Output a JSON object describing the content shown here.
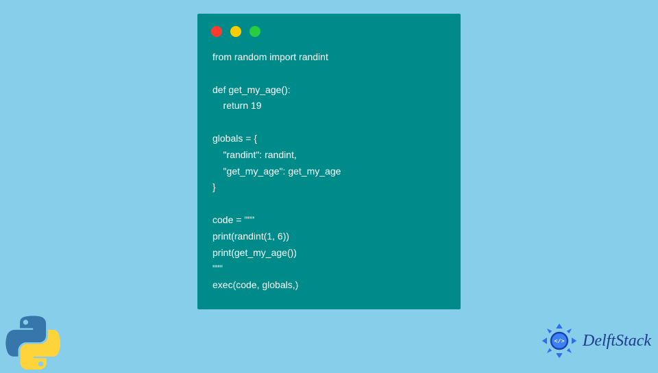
{
  "code": {
    "lines": "from random import randint\n\ndef get_my_age():\n    return 19\n\nglobals = {\n    \"randint\": randint,\n    \"get_my_age\": get_my_age\n}\n\ncode = \"\"\"\nprint(randint(1, 6))\nprint(get_my_age())\n\"\"\"\nexec(code, globals,)"
  },
  "brand": {
    "name": "DelftStack"
  },
  "colors": {
    "background": "#87CEEB",
    "window": "#008B8B",
    "traffic_red": "#FF3B30",
    "traffic_yellow": "#FFCC00",
    "traffic_green": "#28CD41"
  }
}
